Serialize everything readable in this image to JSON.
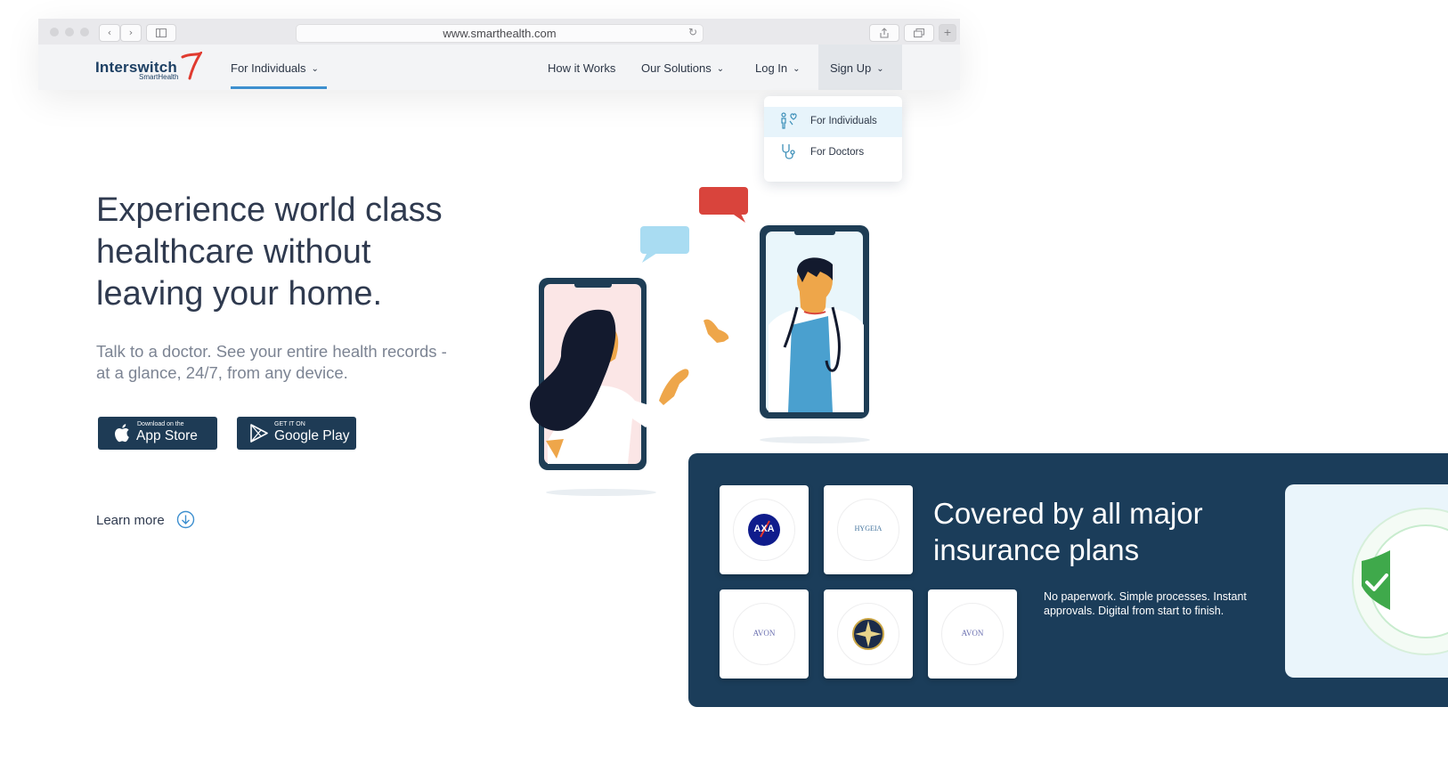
{
  "browser": {
    "url": "www.smarthealth.com",
    "back_icon": "chevron-left-icon",
    "forward_icon": "chevron-right-icon",
    "reload_icon": "reload-icon"
  },
  "nav": {
    "logo_main": "Interswitch",
    "logo_sub": "SmartHealth",
    "left_item": "For Individuals",
    "items": [
      "How it Works",
      "Our Solutions",
      "Log In",
      "Sign Up"
    ]
  },
  "dropdown": {
    "items": [
      {
        "label": "For Individuals",
        "icon": "patients-icon"
      },
      {
        "label": "For Doctors",
        "icon": "stethoscope-icon"
      }
    ]
  },
  "hero": {
    "headline_lines": [
      "Experience world class",
      "healthcare without",
      "leaving your home."
    ],
    "sub_lines": [
      "Talk to a doctor. See your entire health records -",
      "at a glance, 24/7, from any device."
    ],
    "appstore_small": "Download on the",
    "appstore_big": "App Store",
    "googleplay_small": "GET IT ON",
    "googleplay_big": "Google Play",
    "learn_more": "Learn more"
  },
  "insurance": {
    "title_lines": [
      "Covered by all major",
      "insurance plans"
    ],
    "subtitle_lines": [
      "No paperwork. Simple processes. Instant",
      "approvals. Digital from start to finish."
    ],
    "logos": [
      "AXA",
      "HYGEIA",
      "AVON",
      "",
      "AVON"
    ]
  },
  "colors": {
    "brand_navy": "#1b3d5a",
    "accent_blue": "#3d8fcf",
    "logo_red": "#e03a2f",
    "bubble_red": "#d9443c",
    "bubble_blue": "#a9dcf2"
  }
}
